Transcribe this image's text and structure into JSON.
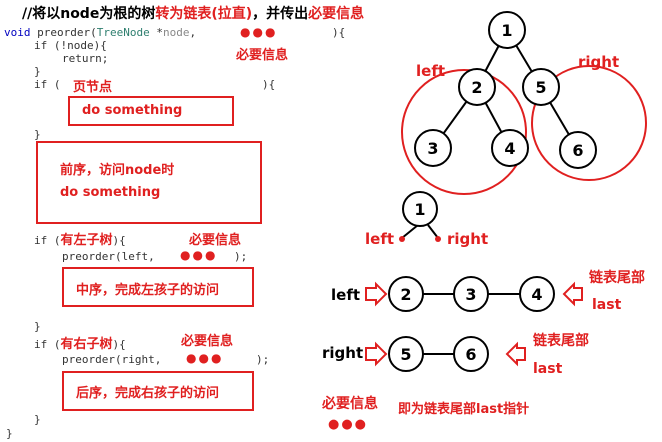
{
  "title": {
    "prefix": "//将以node为根的树",
    "mid1": "转为链表(拉直)",
    "mid2": "，并传出",
    "mid3": "必要信息"
  },
  "code": {
    "signature_kw": "void",
    "signature_fn": " preorder(",
    "signature_type": "TreeNode",
    "signature_ptr": " *",
    "signature_param": "node",
    "signature_comma": ",",
    "signature_end": "){",
    "if_null": "if (!node){",
    "return_stmt": "return;",
    "close_brace_1": "}",
    "if_leaf_open": "if (",
    "if_leaf_close": "){",
    "close_brace_2": "}",
    "if_left_open": "if (",
    "if_left_cond": "有左子树",
    "if_left_close": "){",
    "call_left": "preorder(left,",
    "call_left_end": ");",
    "close_brace_3": "}",
    "if_right_open": "if (",
    "if_right_cond": "有右子树",
    "if_right_close": "){",
    "call_right": "preorder(right,",
    "call_right_end": ");",
    "close_brace_4": "}",
    "close_brace_5": "}"
  },
  "notes": {
    "sig_dots": "●●●",
    "sig_info": "必要信息",
    "leaf_label": "页节点",
    "leaf_box": "do something",
    "pre_box_line1": "前序，访问node时",
    "pre_box_line2": "do something",
    "left_dots": "●●●",
    "left_info": "必要信息",
    "mid_box": "中序，完成左孩子的访问",
    "right_dots": "●●●",
    "right_info": "必要信息",
    "post_box": "后序，完成右孩子的访问"
  },
  "tree": {
    "n1": "1",
    "n2": "2",
    "n3": "3",
    "n4": "4",
    "n5": "5",
    "n6": "6",
    "left_label": "left",
    "right_label": "right"
  },
  "small_tree": {
    "node": "1",
    "left_label": "left",
    "right_label": "right"
  },
  "list_left": {
    "label": "left",
    "nodes": [
      "2",
      "3",
      "4"
    ],
    "tail_label": "链表尾部",
    "tail_word": "last"
  },
  "list_right": {
    "label": "right",
    "nodes": [
      "5",
      "6"
    ],
    "tail_label": "链表尾部",
    "tail_word": "last"
  },
  "footer": {
    "info": "必要信息",
    "desc": "即为链表尾部last指针",
    "dots": "●●●"
  },
  "colors": {
    "accent": "#e02020",
    "node_border": "#000000"
  }
}
